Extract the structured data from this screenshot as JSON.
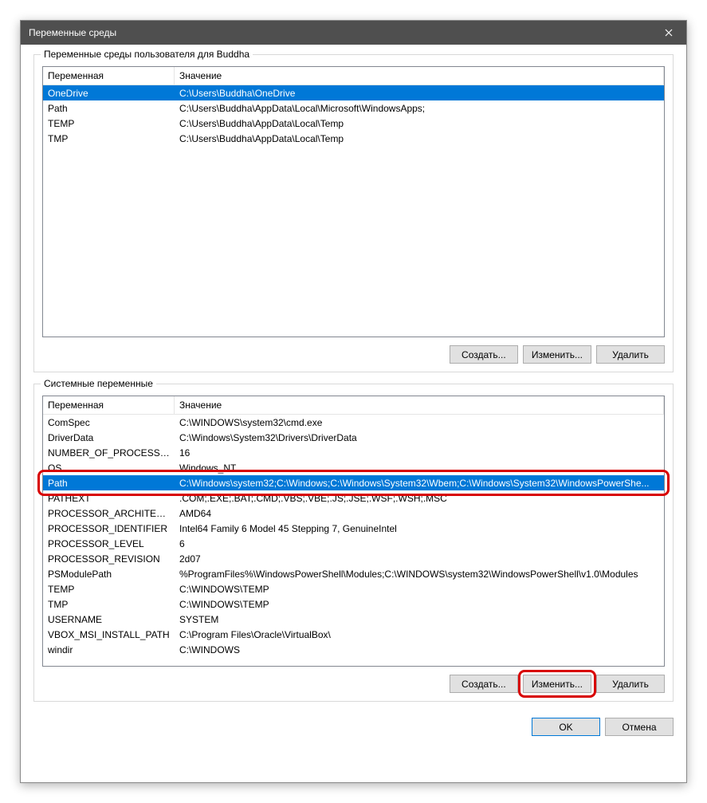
{
  "window": {
    "title": "Переменные среды"
  },
  "userGroup": {
    "title": "Переменные среды пользователя для Buddha",
    "colVar": "Переменная",
    "colVal": "Значение",
    "rows": [
      {
        "var": "OneDrive",
        "val": "C:\\Users\\Buddha\\OneDrive"
      },
      {
        "var": "Path",
        "val": "C:\\Users\\Buddha\\AppData\\Local\\Microsoft\\WindowsApps;"
      },
      {
        "var": "TEMP",
        "val": "C:\\Users\\Buddha\\AppData\\Local\\Temp"
      },
      {
        "var": "TMP",
        "val": "C:\\Users\\Buddha\\AppData\\Local\\Temp"
      }
    ],
    "selected": 0,
    "btnCreate": "Создать...",
    "btnEdit": "Изменить...",
    "btnDelete": "Удалить"
  },
  "sysGroup": {
    "title": "Системные переменные",
    "colVar": "Переменная",
    "colVal": "Значение",
    "rows": [
      {
        "var": "ComSpec",
        "val": "C:\\WINDOWS\\system32\\cmd.exe"
      },
      {
        "var": "DriverData",
        "val": "C:\\Windows\\System32\\Drivers\\DriverData"
      },
      {
        "var": "NUMBER_OF_PROCESSORS",
        "val": "16"
      },
      {
        "var": "OS",
        "val": "Windows_NT"
      },
      {
        "var": "Path",
        "val": "C:\\Windows\\system32;C:\\Windows;C:\\Windows\\System32\\Wbem;C:\\Windows\\System32\\WindowsPowerShe..."
      },
      {
        "var": "PATHEXT",
        "val": ".COM;.EXE;.BAT;.CMD;.VBS;.VBE;.JS;.JSE;.WSF;.WSH;.MSC"
      },
      {
        "var": "PROCESSOR_ARCHITECTURE",
        "val": "AMD64"
      },
      {
        "var": "PROCESSOR_IDENTIFIER",
        "val": "Intel64 Family 6 Model 45 Stepping 7, GenuineIntel"
      },
      {
        "var": "PROCESSOR_LEVEL",
        "val": "6"
      },
      {
        "var": "PROCESSOR_REVISION",
        "val": "2d07"
      },
      {
        "var": "PSModulePath",
        "val": "%ProgramFiles%\\WindowsPowerShell\\Modules;C:\\WINDOWS\\system32\\WindowsPowerShell\\v1.0\\Modules"
      },
      {
        "var": "TEMP",
        "val": "C:\\WINDOWS\\TEMP"
      },
      {
        "var": "TMP",
        "val": "C:\\WINDOWS\\TEMP"
      },
      {
        "var": "USERNAME",
        "val": "SYSTEM"
      },
      {
        "var": "VBOX_MSI_INSTALL_PATH",
        "val": "C:\\Program Files\\Oracle\\VirtualBox\\"
      },
      {
        "var": "windir",
        "val": "C:\\WINDOWS"
      }
    ],
    "selected": 4,
    "btnCreate": "Создать...",
    "btnEdit": "Изменить...",
    "btnDelete": "Удалить"
  },
  "footer": {
    "ok": "OK",
    "cancel": "Отмена"
  }
}
